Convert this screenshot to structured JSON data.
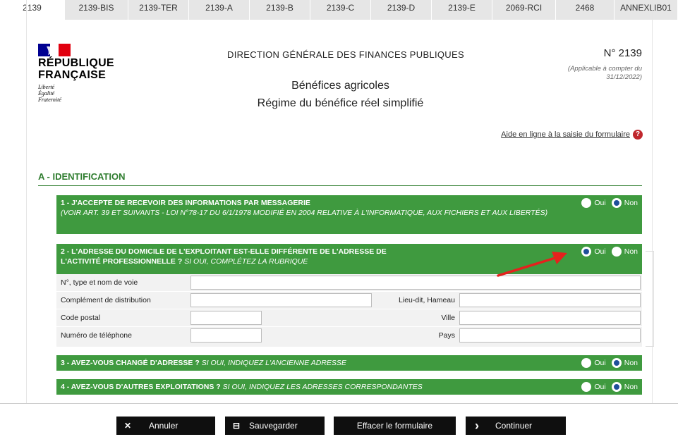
{
  "tabs": [
    {
      "label": "2139",
      "active": true
    },
    {
      "label": "2139-BIS"
    },
    {
      "label": "2139-TER"
    },
    {
      "label": "2139-A"
    },
    {
      "label": "2139-B"
    },
    {
      "label": "2139-C"
    },
    {
      "label": "2139-D"
    },
    {
      "label": "2139-E"
    },
    {
      "label": "2069-RCI"
    },
    {
      "label": "2468"
    },
    {
      "label": "ANNEXLIB01"
    }
  ],
  "logo": {
    "line1": "RÉPUBLIQUE",
    "line2": "FRANÇAISE",
    "motto1": "Liberté",
    "motto2": "Égalité",
    "motto3": "Fraternité"
  },
  "header": {
    "dgfip": "DIRECTION GÉNÉRALE DES FINANCES PUBLIQUES",
    "form_number": "N° 2139",
    "applicable": "(Applicable à compter du 31/12/2022)",
    "title": "Bénéfices agricoles",
    "subtitle": "Régime du bénéfice réel simplifié",
    "help_link": "Aide en ligne à la saisie du formulaire",
    "help_icon": "?"
  },
  "section": {
    "title": "A - IDENTIFICATION"
  },
  "radio_labels": {
    "yes": "Oui",
    "no": "Non"
  },
  "questions": [
    {
      "label": "1 - J'ACCEPTE DE RECEVOIR DES INFORMATIONS PAR MESSAGERIE",
      "note": "(VOIR ART. 39 ET SUIVANTS - LOI N°78-17 DU 6/1/1978 MODIFIÉ EN 2004 RELATIVE À L'INFORMATIQUE, AUX FICHIERS ET AUX LIBERTÉS)",
      "selected": "Non"
    },
    {
      "label": "2 - L'ADRESSE DU DOMICILE DE L'EXPLOITANT EST-ELLE DIFFÉRENTE DE L'ADRESSE DE L'ACTIVITÉ PROFESSIONNELLE ?",
      "note": "SI OUI, COMPLÉTEZ LA RUBRIQUE",
      "selected": "Oui"
    },
    {
      "label": "3 - AVEZ-VOUS CHANGÉ D'ADRESSE ?",
      "note": "SI OUI, INDIQUEZ L'ANCIENNE ADRESSE",
      "selected": "Non"
    },
    {
      "label": "4 - AVEZ-VOUS D'AUTRES EXPLOITATIONS ?",
      "note": "SI OUI, INDIQUEZ LES ADRESSES CORRESPONDANTES",
      "selected": "Non"
    }
  ],
  "address_form": {
    "street_label": "N°, type et nom de voie",
    "street_value": "",
    "complement_label": "Complément de distribution",
    "complement_value": "",
    "lieudit_label": "Lieu-dit, Hameau",
    "lieudit_value": "",
    "postal_label": "Code postal",
    "postal_value": "",
    "city_label": "Ville",
    "city_value": "",
    "phone_label": "Numéro de téléphone",
    "phone_value": "",
    "country_label": "Pays",
    "country_value": ""
  },
  "footer": {
    "cancel": "Annuler",
    "cancel_icon": "✕",
    "save": "Sauvegarder",
    "save_icon": "⊟",
    "clear": "Effacer le formulaire",
    "continue": "Continuer",
    "continue_icon": "›"
  },
  "colors": {
    "green": "#3f9a3f",
    "section_green": "#2f7d2f",
    "radio_selected": "#1f4f9a",
    "annotation_arrow": "#e5211d",
    "button_bg": "#0f0f0f"
  }
}
